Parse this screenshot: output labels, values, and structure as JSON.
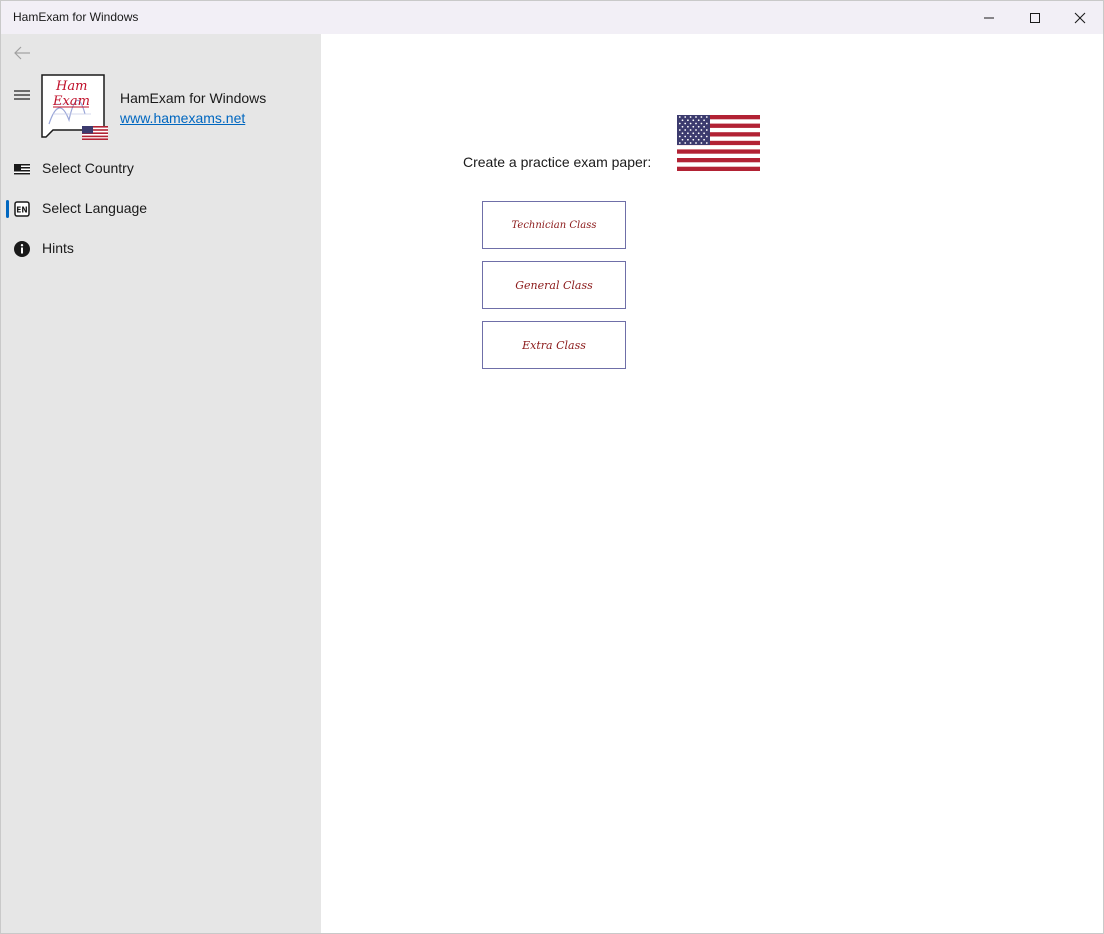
{
  "window": {
    "title": "HamExam for Windows"
  },
  "sidebar": {
    "app_name": "HamExam for Windows",
    "app_link": "www.hamexams.net",
    "logo_text_top": "Ham",
    "logo_text_bottom": "Exam",
    "items": [
      {
        "label": "Select Country",
        "icon": "flag-icon",
        "selected": false
      },
      {
        "label": "Select Language",
        "icon": "language-en-icon",
        "selected": true
      },
      {
        "label": "Hints",
        "icon": "info-icon",
        "selected": false
      }
    ],
    "language_badge": "EN"
  },
  "main": {
    "prompt": "Create a practice exam paper:",
    "flag": "us-flag",
    "exam_buttons": [
      {
        "label": "Technician Class"
      },
      {
        "label": "General Class"
      },
      {
        "label": "Extra Class"
      }
    ]
  },
  "colors": {
    "sidebar_bg": "#e6e6e6",
    "titlebar_bg": "#f2eff6",
    "accent": "#0067c0",
    "exam_text": "#8b1a1a",
    "exam_border": "#6f6fa8",
    "flag_red": "#b22234",
    "flag_blue": "#3c3b6e"
  }
}
